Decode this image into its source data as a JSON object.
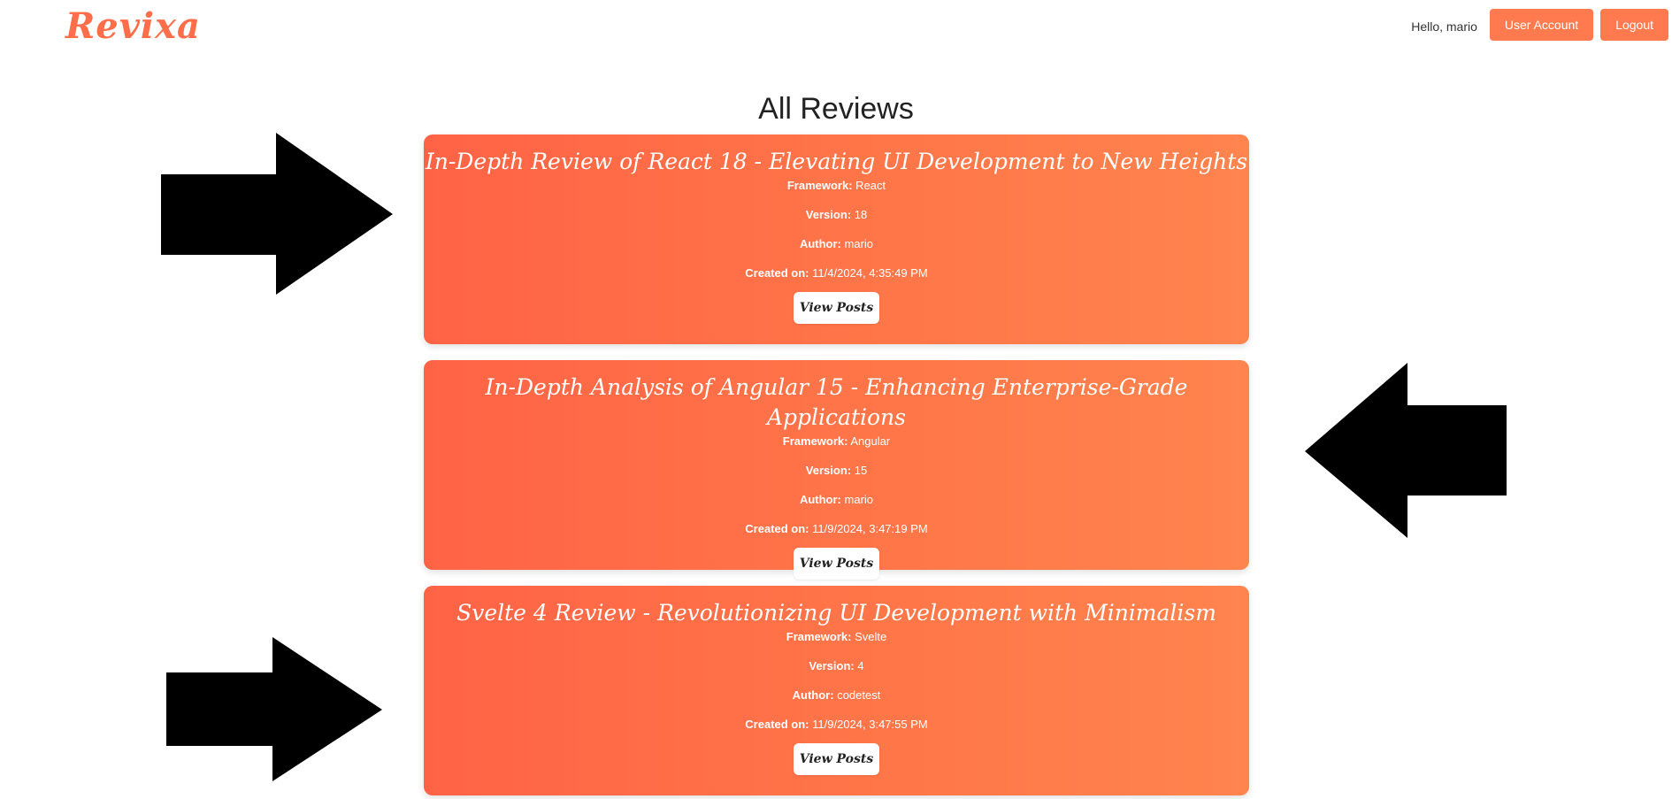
{
  "app": {
    "logo_text": "Revixa",
    "brand_color": "#ff6e4a"
  },
  "header": {
    "greeting": "Hello, mario",
    "user_account_label": "User Account",
    "logout_label": "Logout"
  },
  "main": {
    "title": "All Reviews",
    "reviews": [
      {
        "title": "In-Depth Review of React 18 - Elevating UI Development to New Heights",
        "framework_label": "Framework:",
        "framework": "React",
        "version_label": "Version:",
        "version": "18",
        "author_label": "Author:",
        "author": "mario",
        "created_label": "Created on:",
        "created": "11/4/2024, 4:35:49 PM",
        "button_label": "View Posts"
      },
      {
        "title": "In-Depth Analysis of Angular 15 - Enhancing Enterprise-Grade Applications",
        "framework_label": "Framework:",
        "framework": "Angular",
        "version_label": "Version:",
        "version": "15",
        "author_label": "Author:",
        "author": "mario",
        "created_label": "Created on:",
        "created": "11/9/2024, 3:47:19 PM",
        "button_label": "View Posts"
      },
      {
        "title": "Svelte 4 Review - Revolutionizing UI Development with Minimalism",
        "framework_label": "Framework:",
        "framework": "Svelte",
        "version_label": "Version:",
        "version": "4",
        "author_label": "Author:",
        "author": "codetest",
        "created_label": "Created on:",
        "created": "11/9/2024, 3:47:55 PM",
        "button_label": "View Posts"
      }
    ]
  },
  "annotations": {
    "arrow_color": "#000000",
    "arrows": [
      "arrow-right-icon",
      "arrow-left-icon",
      "arrow-right-icon"
    ]
  }
}
